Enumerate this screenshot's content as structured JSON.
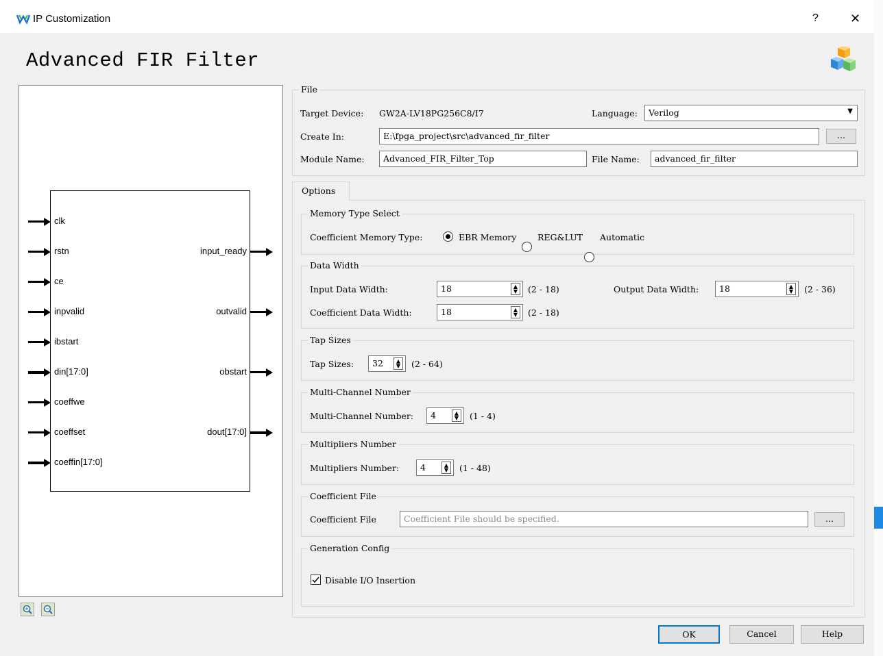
{
  "window": {
    "title": "IP Customization",
    "help_label": "?",
    "close_label": "✕"
  },
  "header": {
    "title": "Advanced FIR Filter"
  },
  "diagram": {
    "inputs": [
      "clk",
      "rstn",
      "ce",
      "inpvalid",
      "ibstart",
      "din[17:0]",
      "coeffwe",
      "coeffset",
      "coeffin[17:0]"
    ],
    "outputs": [
      "input_ready",
      "outvalid",
      "obstart",
      "dout[17:0]"
    ]
  },
  "file": {
    "legend": "File",
    "target_device_label": "Target Device:",
    "target_device_value": "GW2A-LV18PG256C8/I7",
    "language_label": "Language:",
    "language_value": "Verilog",
    "create_in_label": "Create In:",
    "create_in_value": "E:\\fpga_project\\src\\advanced_fir_filter",
    "browse_label": "...",
    "module_name_label": "Module Name:",
    "module_name_value": "Advanced_FIR_Filter_Top",
    "file_name_label": "File Name:",
    "file_name_value": "advanced_fir_filter"
  },
  "tabs": {
    "options": "Options"
  },
  "options": {
    "memory": {
      "legend": "Memory Type Select",
      "label": "Coefficient Memory Type:",
      "choices": [
        "EBR Memory",
        "REG&LUT",
        "Automatic"
      ],
      "selected": "EBR Memory"
    },
    "data_width": {
      "legend": "Data Width",
      "input_label": "Input Data Width:",
      "input_value": "18",
      "input_range": "(2 - 18)",
      "output_label": "Output Data Width:",
      "output_value": "18",
      "output_range": "(2 - 36)",
      "coeff_label": "Coefficient Data Width:",
      "coeff_value": "18",
      "coeff_range": "(2 - 18)"
    },
    "tap": {
      "legend": "Tap Sizes",
      "label": "Tap Sizes:",
      "value": "32",
      "range": "(2 - 64)"
    },
    "channel": {
      "legend": "Multi-Channel Number",
      "label": "Multi-Channel Number:",
      "value": "4",
      "range": "(1 - 4)"
    },
    "multipliers": {
      "legend": "Multipliers Number",
      "label": "Multipliers Number:",
      "value": "4",
      "range": "(1 - 48)"
    },
    "coeff_file": {
      "legend": "Coefficient File",
      "label": "Coefficient File",
      "placeholder": "Coefficient File should be specified.",
      "browse_label": "..."
    },
    "generation": {
      "legend": "Generation Config",
      "disable_io_label": "Disable I/O Insertion",
      "disable_io_checked": true
    }
  },
  "buttons": {
    "ok": "OK",
    "cancel": "Cancel",
    "help": "Help"
  },
  "icons": {
    "app": "gowin-logo-icon",
    "ip": "ip-cubes-icon",
    "zoom_in": "zoom-in-icon",
    "zoom_out": "zoom-out-icon"
  }
}
